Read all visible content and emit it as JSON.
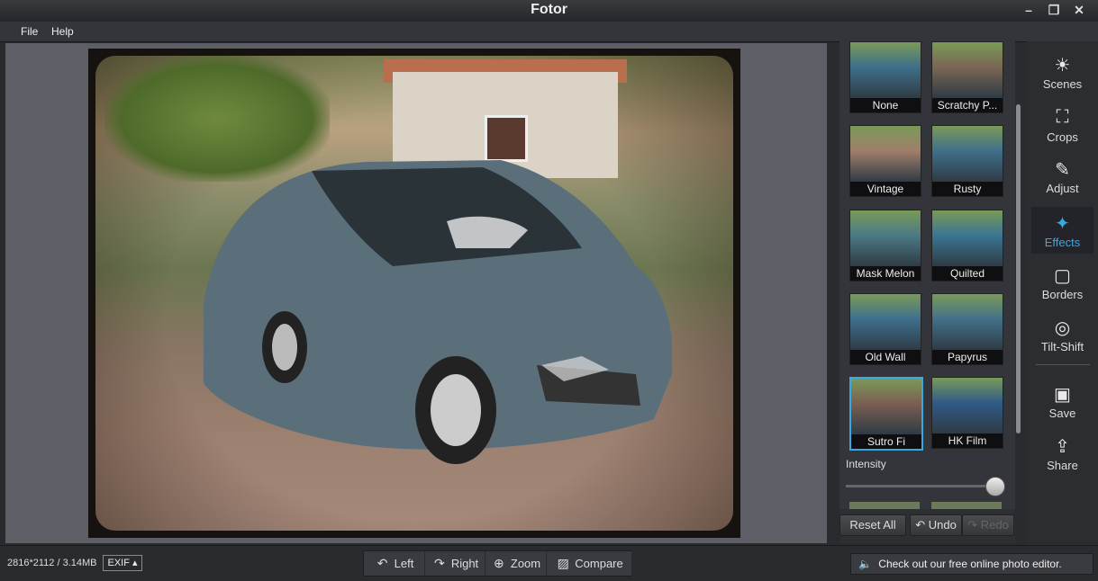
{
  "window": {
    "title": "Fotor",
    "min_glyph": "–",
    "max_glyph": "❐",
    "close_glyph": "✕"
  },
  "menu": {
    "file": "File",
    "help": "Help"
  },
  "effects": [
    {
      "label": "None",
      "tint": "#3d6f8a"
    },
    {
      "label": "Scratchy P...",
      "tint": "#7a6654"
    },
    {
      "label": "Vintage",
      "tint": "#a07e6b"
    },
    {
      "label": "Rusty",
      "tint": "#3f6f8a"
    },
    {
      "label": "Mask Melon",
      "tint": "#4a7a86"
    },
    {
      "label": "Quilted",
      "tint": "#3a7592"
    },
    {
      "label": "Old Wall",
      "tint": "#3e6f8e"
    },
    {
      "label": "Papyrus",
      "tint": "#42708a"
    },
    {
      "label": "Sutro Fi",
      "tint": "#7a5e52",
      "selected": true
    },
    {
      "label": "HK Film",
      "tint": "#2f5a86"
    }
  ],
  "intensity": {
    "label": "Intensity",
    "value": 1.0
  },
  "actions": {
    "reset": "Reset All",
    "undo": "Undo",
    "redo": "Redo"
  },
  "sidebar": {
    "items": [
      {
        "label": "Scenes",
        "icon": "☀"
      },
      {
        "label": "Crops",
        "icon": "⛶"
      },
      {
        "label": "Adjust",
        "icon": "✎"
      },
      {
        "label": "Effects",
        "icon": "✦",
        "active": true
      },
      {
        "label": "Borders",
        "icon": "▢"
      },
      {
        "label": "Tilt-Shift",
        "icon": "◎"
      },
      {
        "label": "Save",
        "icon": "▣"
      },
      {
        "label": "Share",
        "icon": "⇪"
      }
    ]
  },
  "status": {
    "fileinfo": "2816*2112 / 3.14MB",
    "exif": "EXIF ▴",
    "tools": [
      {
        "label": "Left",
        "icon": "↶"
      },
      {
        "label": "Right",
        "icon": "↷"
      },
      {
        "label": "Zoom",
        "icon": "⊕"
      },
      {
        "label": "Compare",
        "icon": "▨"
      }
    ],
    "promo": "Check out our free online photo editor.",
    "promo_icon": "🔈"
  },
  "colors": {
    "accent": "#39a9e2"
  }
}
